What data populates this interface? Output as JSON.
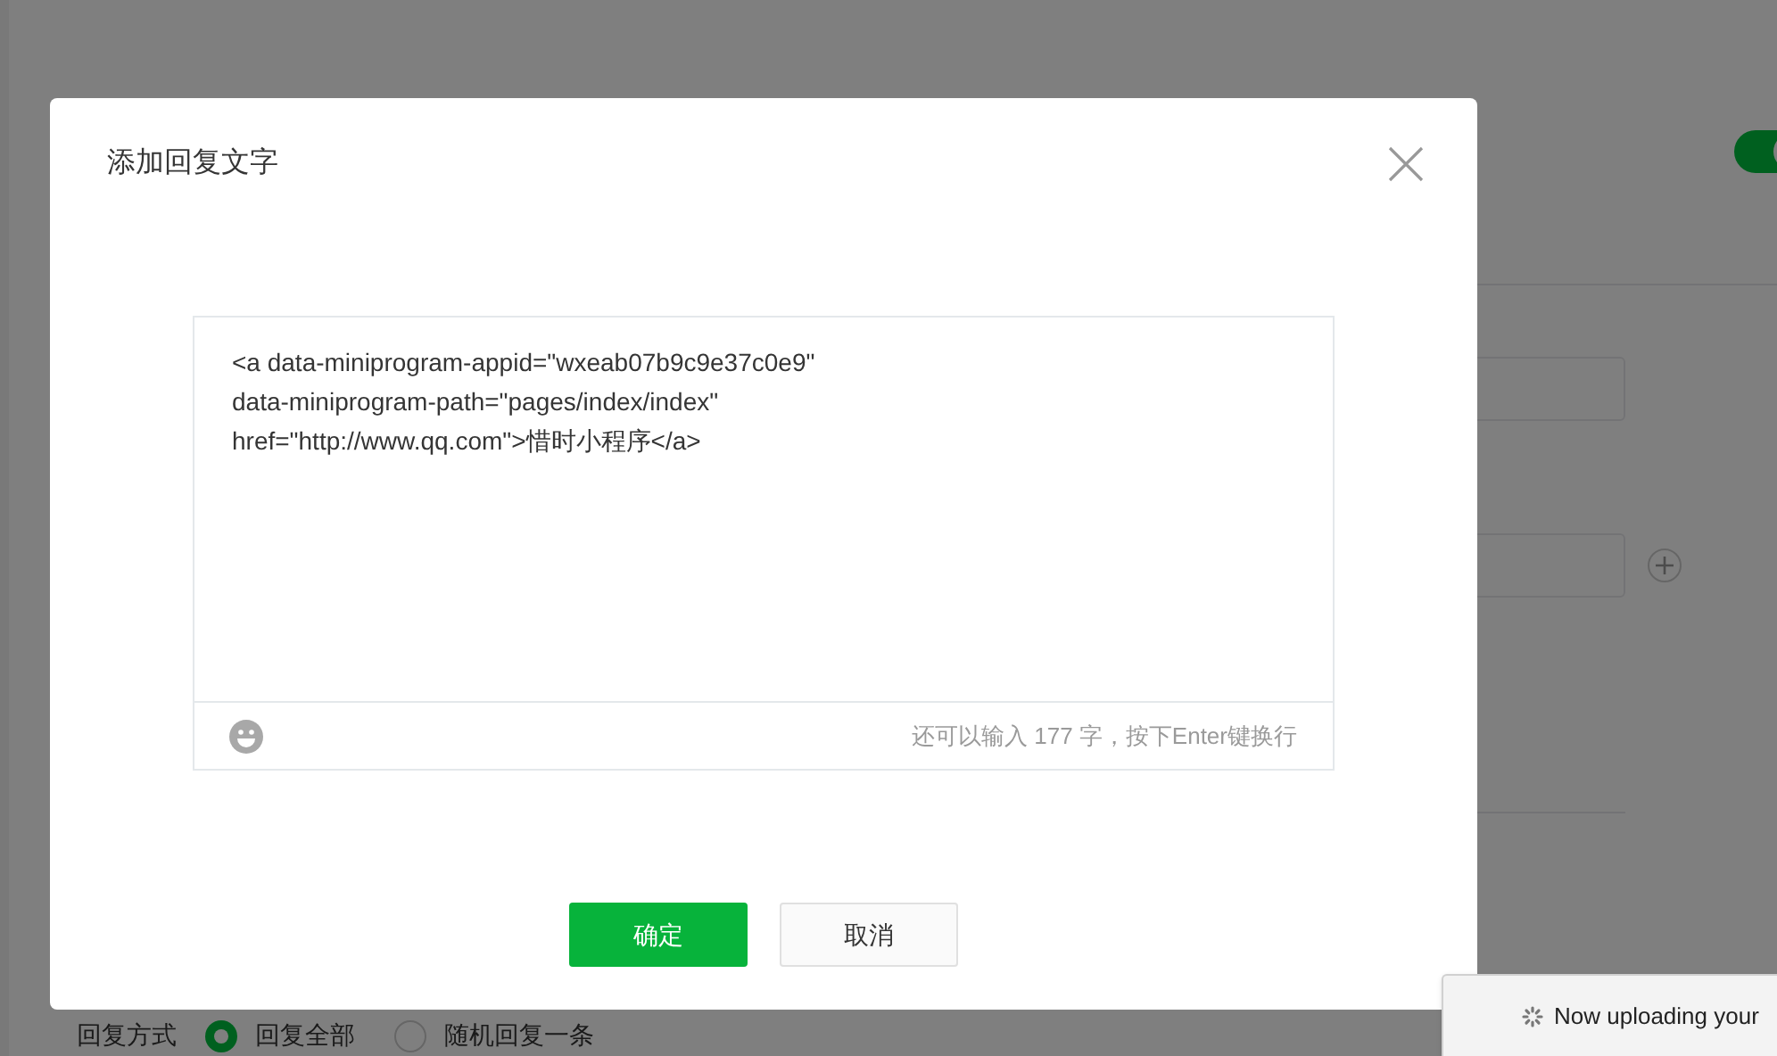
{
  "page": {
    "toggle_on": true,
    "reply_mode": {
      "label": "回复方式",
      "options": [
        {
          "label": "回复全部",
          "selected": true
        },
        {
          "label": "随机回复一条",
          "selected": false
        }
      ]
    }
  },
  "dialog": {
    "title": "添加回复文字",
    "text": "<a data-miniprogram-appid=\"wxeab07b9c9e37c0e9\"\ndata-miniprogram-path=\"pages/index/index\"\nhref=\"http://www.qq.com\">惜时小程序</a>",
    "counter": "还可以输入 177 字，按下Enter键换行",
    "buttons": [
      {
        "label": "确定",
        "kind": "primary"
      },
      {
        "label": "取消",
        "kind": "secondary"
      }
    ]
  },
  "toast": {
    "text": "Now uploading your"
  }
}
